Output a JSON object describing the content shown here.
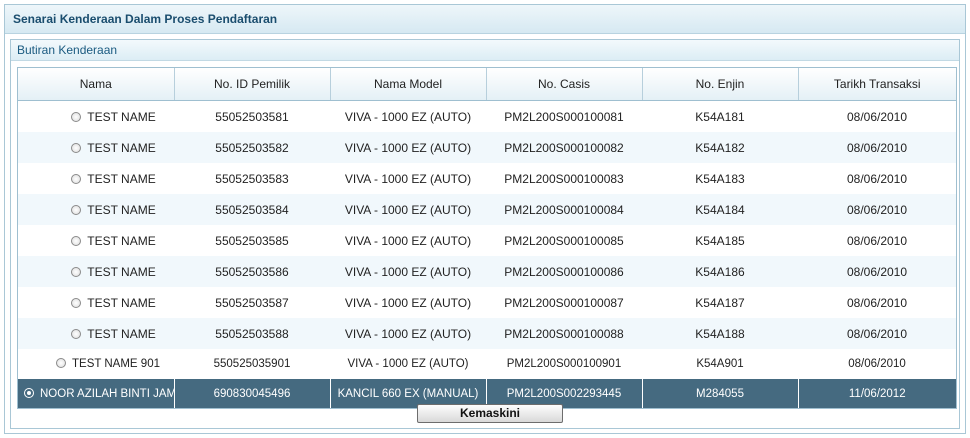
{
  "panel": {
    "title": "Senarai Kenderaan Dalam Proses Pendaftaran"
  },
  "section": {
    "title": "Butiran Kenderaan"
  },
  "table": {
    "columns": [
      "Nama",
      "No. ID Pemilik",
      "Nama Model",
      "No. Casis",
      "No. Enjin",
      "Tarikh Transaksi"
    ],
    "rows": [
      {
        "nama": "TEST NAME",
        "id": "55052503581",
        "model": "VIVA - 1000 EZ (AUTO)",
        "casis": "PM2L200S000100081",
        "enjin": "K54A181",
        "tarikh": "08/06/2010"
      },
      {
        "nama": "TEST NAME",
        "id": "55052503582",
        "model": "VIVA - 1000 EZ (AUTO)",
        "casis": "PM2L200S000100082",
        "enjin": "K54A182",
        "tarikh": "08/06/2010"
      },
      {
        "nama": "TEST NAME",
        "id": "55052503583",
        "model": "VIVA - 1000 EZ (AUTO)",
        "casis": "PM2L200S000100083",
        "enjin": "K54A183",
        "tarikh": "08/06/2010"
      },
      {
        "nama": "TEST NAME",
        "id": "55052503584",
        "model": "VIVA - 1000 EZ (AUTO)",
        "casis": "PM2L200S000100084",
        "enjin": "K54A184",
        "tarikh": "08/06/2010"
      },
      {
        "nama": "TEST NAME",
        "id": "55052503585",
        "model": "VIVA - 1000 EZ (AUTO)",
        "casis": "PM2L200S000100085",
        "enjin": "K54A185",
        "tarikh": "08/06/2010"
      },
      {
        "nama": "TEST NAME",
        "id": "55052503586",
        "model": "VIVA - 1000 EZ (AUTO)",
        "casis": "PM2L200S000100086",
        "enjin": "K54A186",
        "tarikh": "08/06/2010"
      },
      {
        "nama": "TEST NAME",
        "id": "55052503587",
        "model": "VIVA - 1000 EZ (AUTO)",
        "casis": "PM2L200S000100087",
        "enjin": "K54A187",
        "tarikh": "08/06/2010"
      },
      {
        "nama": "TEST NAME",
        "id": "55052503588",
        "model": "VIVA - 1000 EZ (AUTO)",
        "casis": "PM2L200S000100088",
        "enjin": "K54A188",
        "tarikh": "08/06/2010"
      },
      {
        "nama": "TEST NAME 901",
        "id": "550525035901",
        "model": "VIVA - 1000 EZ (AUTO)",
        "casis": "PM2L200S000100901",
        "enjin": "K54A901",
        "tarikh": "08/06/2010"
      },
      {
        "nama": "NOOR AZILAH BINTI JAMURI",
        "id": "690830045496",
        "model": "KANCIL 660 EX (MANUAL)",
        "casis": "PM2L200S002293445",
        "enjin": "M284055",
        "tarikh": "11/06/2012"
      }
    ]
  },
  "actions": {
    "update_label": "Kemaskini"
  },
  "colors": {
    "selected_row": "#456a80",
    "header_text": "#1a4d6e"
  }
}
